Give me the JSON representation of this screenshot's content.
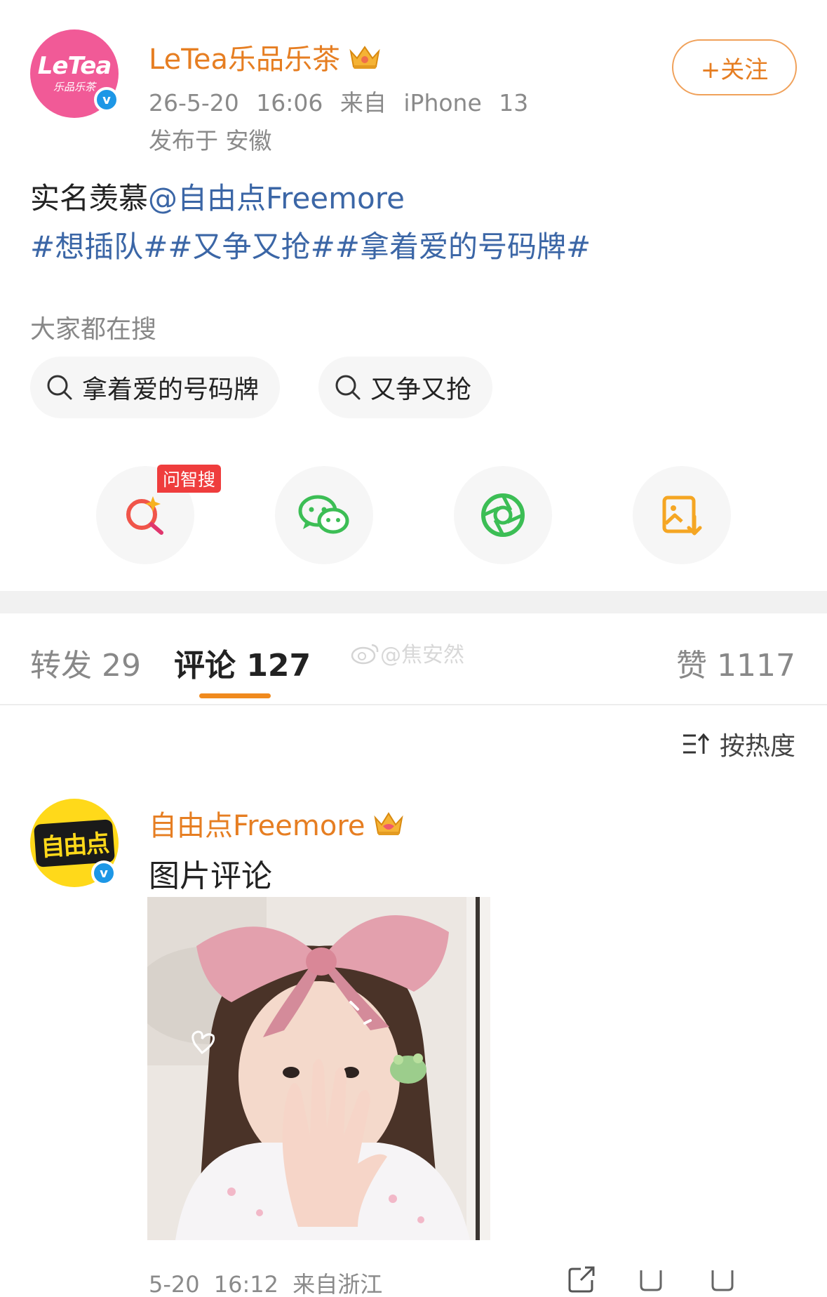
{
  "post": {
    "avatar_text_main": "LeTea",
    "avatar_text_sub": "乐品乐茶",
    "author": "LeTea乐品乐茶",
    "datetime": "26-5-20 16:06",
    "source": "来自 iPhone 13",
    "location": "发布于 安徽",
    "follow_label": "+关注",
    "text_prefix": "实名羡慕",
    "mention": "@自由点Freemore",
    "hashtags": "#想插队##又争又抢##拿着爱的号码牌#"
  },
  "hot_search": {
    "title": "大家都在搜",
    "chips": [
      "拿着爱的号码牌",
      "又争又抢"
    ]
  },
  "share": {
    "ai_tag": "问智搜"
  },
  "tabs": {
    "repost": "转发 29",
    "comment": "评论 127",
    "like": "赞 1117",
    "watermark": "@焦安然"
  },
  "sort": {
    "label": "按热度"
  },
  "comment": {
    "avatar_text": "自由点",
    "author": "自由点Freemore",
    "text": "图片评论",
    "datetime": "5-20 16:12",
    "source": "来自浙江"
  },
  "colors": {
    "accent": "#e67e22",
    "link": "#3b66a6",
    "verified": "#1d97e6",
    "letea_pink": "#f15a97",
    "freemore_yellow": "#ffd91a"
  }
}
